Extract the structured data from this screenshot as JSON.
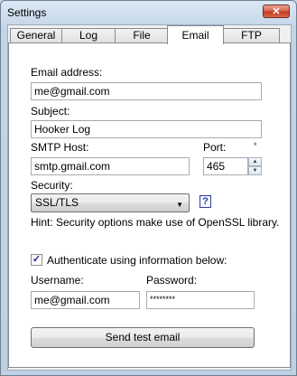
{
  "window": {
    "title": "Settings",
    "close_glyph": "✕"
  },
  "tabs": [
    {
      "label": "General"
    },
    {
      "label": "Log"
    },
    {
      "label": "File"
    },
    {
      "label": "Email"
    },
    {
      "label": "FTP"
    }
  ],
  "email": {
    "address_label": "Email address:",
    "address_value": "me@gmail.com",
    "subject_label": "Subject:",
    "subject_value": "Hooker Log",
    "smtp_label": "SMTP Host:",
    "smtp_value": "smtp.gmail.com",
    "port_label": "Port:",
    "port_value": "465",
    "port_marker": "*",
    "security_label": "Security:",
    "security_value": "SSL/TLS",
    "help_glyph": "?",
    "hint": "Hint: Security options make use of OpenSSL library.",
    "auth_checked": true,
    "auth_label": "Authenticate using information below:",
    "username_label": "Username:",
    "username_value": "me@gmail.com",
    "password_label": "Password:",
    "password_value": "********",
    "send_button": "Send test email"
  }
}
